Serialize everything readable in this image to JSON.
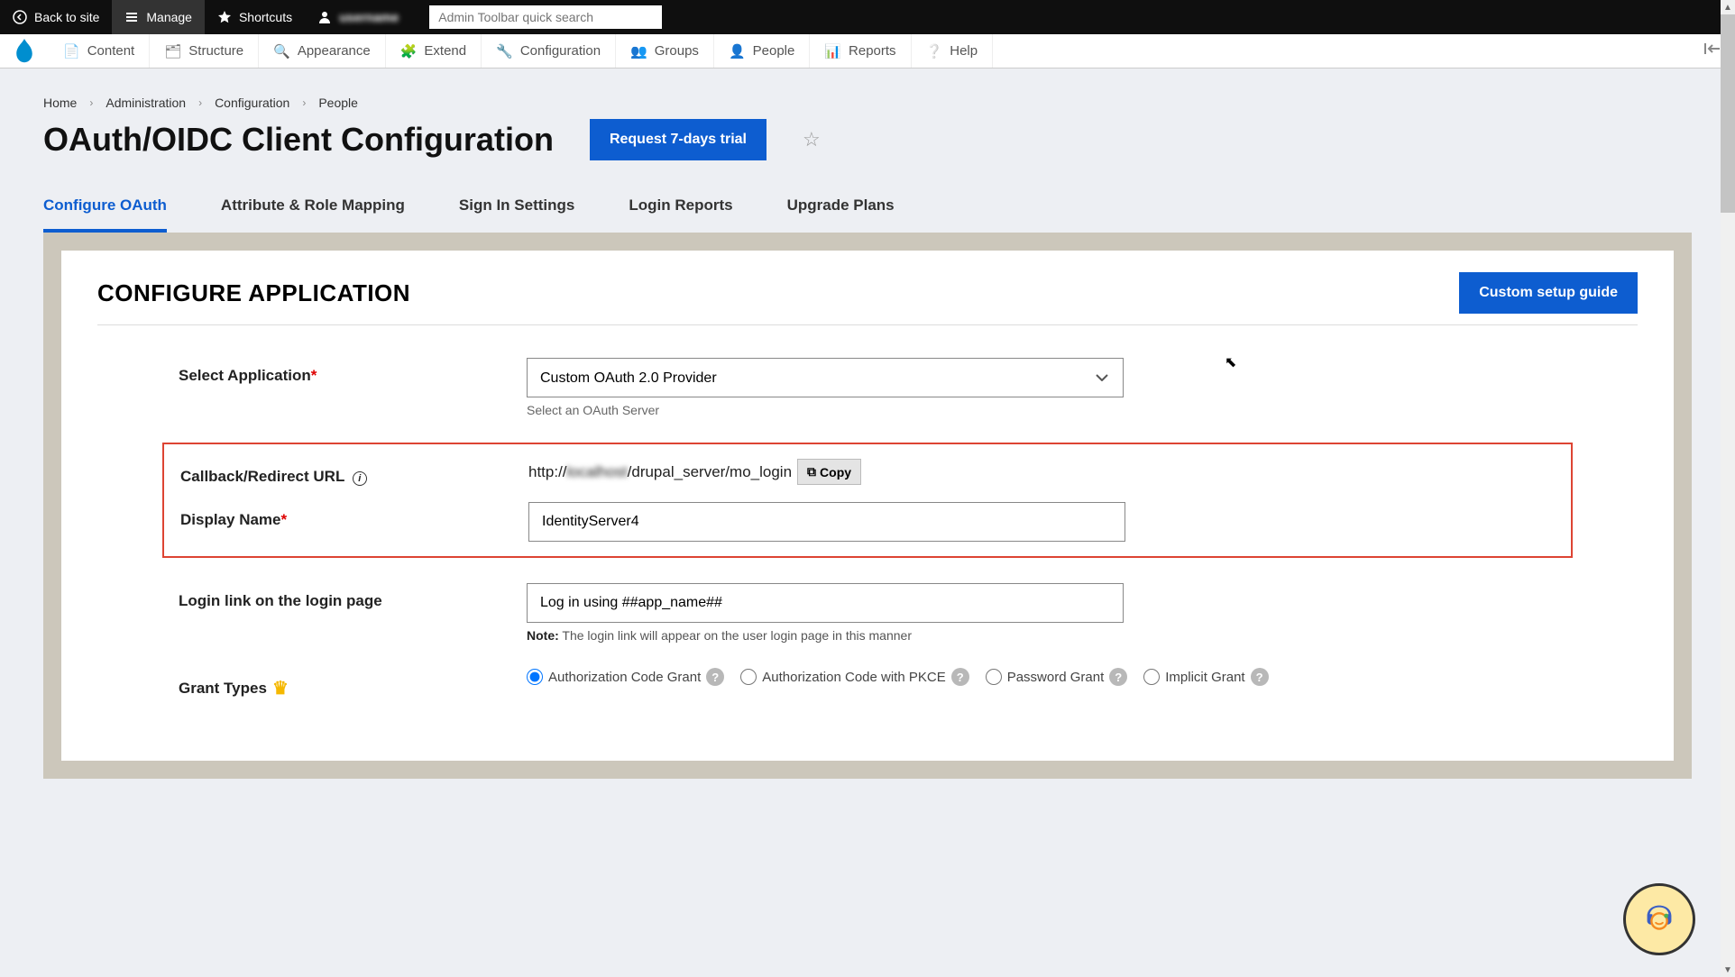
{
  "toolbar": {
    "back": "Back to site",
    "manage": "Manage",
    "shortcuts": "Shortcuts",
    "user": "username",
    "search_placeholder": "Admin Toolbar quick search"
  },
  "nav": {
    "content": "Content",
    "structure": "Structure",
    "appearance": "Appearance",
    "extend": "Extend",
    "configuration": "Configuration",
    "groups": "Groups",
    "people": "People",
    "reports": "Reports",
    "help": "Help"
  },
  "breadcrumb": [
    "Home",
    "Administration",
    "Configuration",
    "People"
  ],
  "page_title": "OAuth/OIDC Client Configuration",
  "trial_button": "Request 7-days trial",
  "tabs": [
    "Configure OAuth",
    "Attribute & Role Mapping",
    "Sign In Settings",
    "Login Reports",
    "Upgrade Plans"
  ],
  "panel": {
    "heading": "CONFIGURE APPLICATION",
    "guide_button": "Custom setup guide",
    "select_app_label": "Select Application",
    "select_app_value": "Custom OAuth 2.0 Provider",
    "select_app_hint": "Select an OAuth Server",
    "callback_label": "Callback/Redirect URL",
    "callback_url_prefix": "http://",
    "callback_url_host": "localhost",
    "callback_url_suffix": "/drupal_server/mo_login",
    "copy_label": "Copy",
    "display_name_label": "Display Name",
    "display_name_value": "IdentityServer4",
    "login_link_label": "Login link on the login page",
    "login_link_value": "Log in using ##app_name##",
    "login_link_note_bold": "Note:",
    "login_link_note": " The login link will appear on the user login page in this manner",
    "grant_label": "Grant Types",
    "grants": [
      {
        "label": "Authorization Code Grant",
        "checked": true
      },
      {
        "label": "Authorization Code with PKCE",
        "checked": false
      },
      {
        "label": "Password Grant",
        "checked": false
      },
      {
        "label": "Implicit Grant",
        "checked": false
      }
    ]
  }
}
